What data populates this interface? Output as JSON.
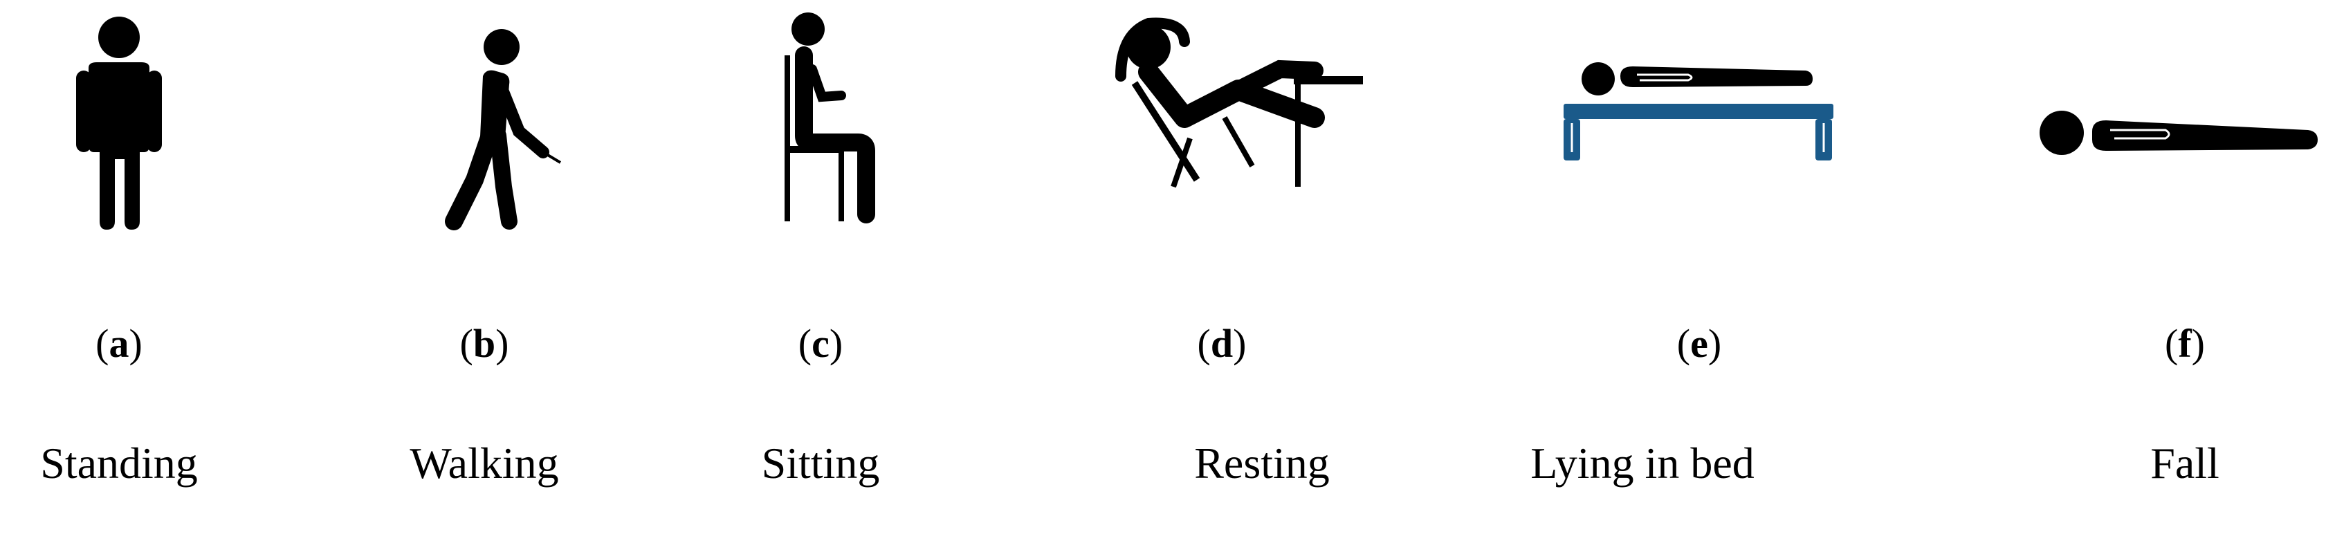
{
  "panels": [
    {
      "letter": "a",
      "caption": "Standing",
      "icon": "standing-person-icon"
    },
    {
      "letter": "b",
      "caption": "Walking",
      "icon": "walking-person-icon"
    },
    {
      "letter": "c",
      "caption": "Sitting",
      "icon": "sitting-person-icon"
    },
    {
      "letter": "d",
      "caption": "Resting",
      "icon": "resting-person-icon"
    },
    {
      "letter": "e",
      "caption": "Lying in bed",
      "icon": "lying-in-bed-icon"
    },
    {
      "letter": "f",
      "caption": "Fall",
      "icon": "fallen-person-icon"
    }
  ],
  "colors": {
    "figure": "#000000",
    "bed": "#1a5a8a"
  }
}
